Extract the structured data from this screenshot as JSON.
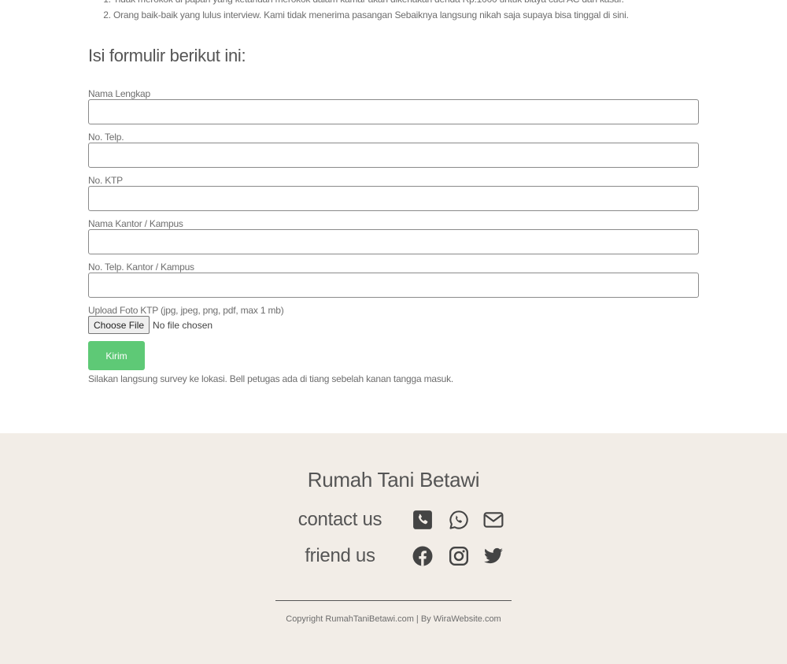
{
  "notes": {
    "item1": "Tidak merokok di papan yang ketahuan merokok dalam kamar akan dikenakan denda Rp.1000 untuk biaya cuci AC dan kasur.",
    "item2": "Orang baik-baik yang lulus interview. Kami tidak menerima pasangan Sebaiknya langsung nikah saja supaya bisa tinggal di sini."
  },
  "form": {
    "heading": "Isi formulir berikut ini:",
    "fields": [
      {
        "label": "Nama Lengkap",
        "value": ""
      },
      {
        "label": "No. Telp.",
        "value": ""
      },
      {
        "label": "No. KTP",
        "value": ""
      },
      {
        "label": "Nama Kantor / Kampus",
        "value": ""
      },
      {
        "label": "No. Telp. Kantor / Kampus",
        "value": ""
      }
    ],
    "upload_label": "Upload Foto KTP (jpg, jpeg, png, pdf, max 1 mb)",
    "file_button": "Choose File",
    "file_status": "No file chosen",
    "submit_label": "Kirim",
    "submit_color": "#5ec976",
    "after_note": "Silakan langsung survey ke lokasi. Bell petugas ada di tiang sebelah kanan tangga masuk."
  },
  "footer": {
    "title": "Rumah Tani Betawi",
    "contact_label": "contact us",
    "contact_icons": [
      "phone-icon",
      "whatsapp-icon",
      "envelope-icon"
    ],
    "friend_label": "friend us",
    "friend_icons": [
      "facebook-icon",
      "instagram-icon",
      "twitter-icon"
    ],
    "copyright": "Copyright RumahTaniBetawi.com | By WiraWebsite.com",
    "background": "#f2ede7"
  }
}
